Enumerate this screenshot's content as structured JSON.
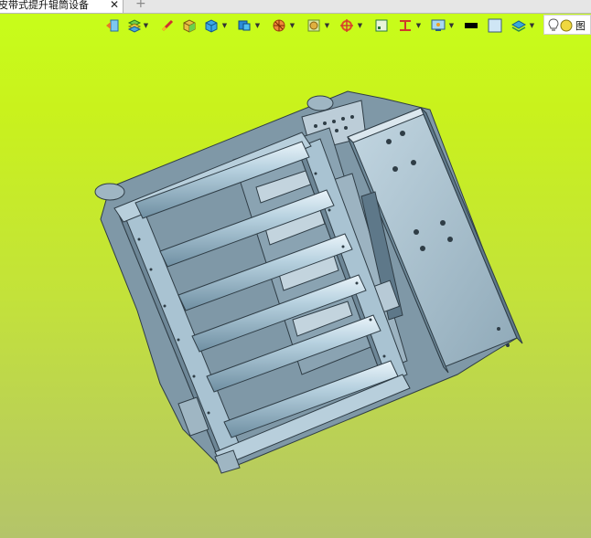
{
  "tab": {
    "title": "皮带式提升辊筒设备",
    "close": "✕",
    "new_tab": "+"
  },
  "toolbar": {
    "icons": [
      "exit-icon",
      "layers-icon",
      "measure-icon",
      "box-icon",
      "cube-icon",
      "display-icon",
      "section-icon",
      "render-icon",
      "transform-icon",
      "frame-icon",
      "dimension-icon",
      "monitor-icon",
      "color-swatch-icon",
      "background-swatch-icon",
      "layer-stack-icon"
    ],
    "swatch_black": "#000000",
    "swatch_light_blue": "#cfe6f5"
  },
  "viewbox": {
    "label": "图"
  },
  "colors": {
    "bg_top": "#c8ff1a",
    "bg_bottom": "#b4c46a",
    "model_body": "#a9c3d2",
    "model_edge": "#2f3d46",
    "model_dark": "#6e8797"
  }
}
